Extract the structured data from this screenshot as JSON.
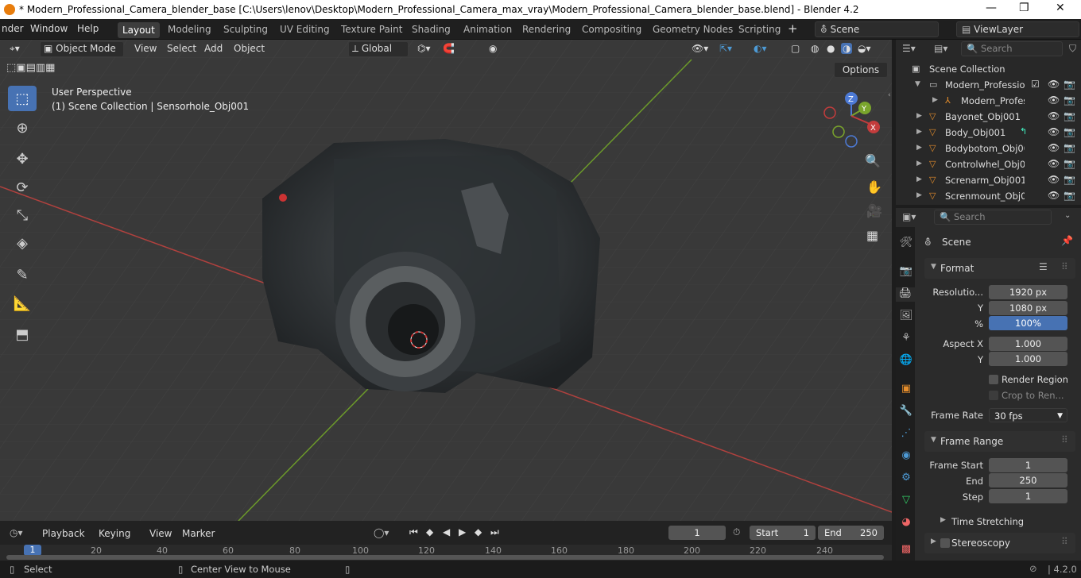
{
  "window": {
    "title": "* Modern_Professional_Camera_blender_base [C:\\Users\\lenov\\Desktop\\Modern_Professional_Camera_max_vray\\Modern_Professional_Camera_blender_base.blend] - Blender 4.2",
    "minimize": "—",
    "maximize": "❐",
    "close": "✕"
  },
  "menubar": {
    "items": [
      "nder",
      "Window",
      "Help"
    ]
  },
  "workspaces": [
    "Layout",
    "Modeling",
    "Sculpting",
    "UV Editing",
    "Texture Paint",
    "Shading",
    "Animation",
    "Rendering",
    "Compositing",
    "Geometry Nodes",
    "Scripting"
  ],
  "active_workspace": "Layout",
  "scene": {
    "label": "Scene",
    "view_layer": "ViewLayer"
  },
  "viewport_header": {
    "mode": "Object Mode",
    "menus": [
      "View",
      "Select",
      "Add",
      "Object"
    ],
    "orientation": "Global",
    "options": "Options"
  },
  "viewport": {
    "perspective": "User Perspective",
    "collection_info": "(1) Scene Collection | Sensorhole_Obj001",
    "gizmo": {
      "x": "X",
      "y": "Y",
      "z": "Z"
    }
  },
  "outliner": {
    "search_placeholder": "Search",
    "root": "Scene Collection",
    "rows": [
      {
        "name": "Modern_Professior",
        "type": "collection"
      },
      {
        "name": "Modern_Profes",
        "type": "armature"
      },
      {
        "name": "Bayonet_Obj001",
        "type": "mesh"
      },
      {
        "name": "Body_Obj001",
        "type": "mesh"
      },
      {
        "name": "Bodybotom_Obj00",
        "type": "mesh"
      },
      {
        "name": "Controlwhel_Obj00",
        "type": "mesh"
      },
      {
        "name": "Screnarm_Obj001",
        "type": "mesh"
      },
      {
        "name": "Screnmount_Obj00",
        "type": "mesh"
      }
    ]
  },
  "properties": {
    "search_placeholder": "Search",
    "context": "Scene",
    "format": {
      "title": "Format",
      "resolution_label": "Resolutio...",
      "res_x": "1920 px",
      "y_label": "Y",
      "res_y": "1080 px",
      "pct_label": "%",
      "pct": "100%",
      "aspect_label": "Aspect X",
      "aspect_x": "1.000",
      "aspect_y_label": "Y",
      "aspect_y": "1.000",
      "render_region": "Render Region",
      "crop": "Crop to Ren...",
      "frame_rate_label": "Frame Rate",
      "frame_rate": "30 fps"
    },
    "frame_range": {
      "title": "Frame Range",
      "start_label": "Frame Start",
      "start": "1",
      "end_label": "End",
      "end": "250",
      "step_label": "Step",
      "step": "1",
      "time_stretching": "Time Stretching",
      "stereoscopy": "Stereoscopy"
    }
  },
  "timeline": {
    "menus": [
      "Playback",
      "Keying",
      "View",
      "Marker"
    ],
    "current_frame": "1",
    "start_label": "Start",
    "start": "1",
    "end_label": "End",
    "end": "250",
    "ticks": [
      "1",
      "20",
      "40",
      "60",
      "80",
      "100",
      "120",
      "140",
      "160",
      "180",
      "200",
      "220",
      "240"
    ]
  },
  "statusbar": {
    "select": "Select",
    "center_view": "Center View to Mouse",
    "version": "4.2.0"
  },
  "colors": {
    "accent": "#4772b3",
    "x_axis": "#c33c3c",
    "y_axis": "#7aa52c",
    "bg_viewport": "#393939"
  }
}
